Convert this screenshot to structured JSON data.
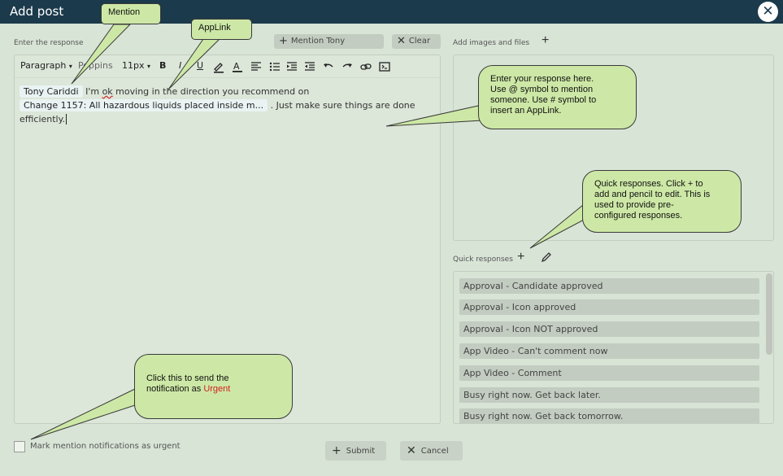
{
  "window": {
    "title": "Add post",
    "close_icon": "close-icon"
  },
  "response": {
    "label": "Enter the response",
    "mention_button": "Mention Tony",
    "clear_button": "Clear"
  },
  "toolbar": {
    "block_format": "Paragraph",
    "font_family": "Poppins",
    "font_size": "11px",
    "bold": "B",
    "italic": "I",
    "underline": "U",
    "text_color": "A",
    "icons": [
      "bold-icon",
      "italic-icon",
      "underline-icon",
      "highlight-icon",
      "text-color-icon",
      "align-left-icon",
      "bullet-list-icon",
      "indent-icon",
      "outdent-icon",
      "undo-icon",
      "redo-icon",
      "link-icon",
      "code-icon"
    ]
  },
  "editor": {
    "mention_chip": "Tony Cariddi",
    "text_1": "I'm ",
    "text_ok": "ok",
    "text_2": " moving in the direction you recommend on",
    "applink_chip": "Change 1157: All hazardous liquids placed inside m...",
    "text_3": ".  Just make sure things are done",
    "text_4": "efficiently."
  },
  "attachments": {
    "label": "Add images and files"
  },
  "quick_responses": {
    "label": "Quick responses",
    "items": [
      "Approval - Candidate approved",
      "Approval - Icon approved",
      "Approval - Icon NOT approved",
      "App Video - Can't comment now",
      "App Video - Comment",
      "Busy right now.  Get back later.",
      "Busy right now. Get back tomorrow."
    ]
  },
  "footer": {
    "urgent_label": "Mark mention notifications as urgent",
    "submit": "Submit",
    "cancel": "Cancel"
  },
  "callouts": {
    "mention": "Mention",
    "applink": "AppLink",
    "editor_line1": "Enter your response here.",
    "editor_line2": "Use @ symbol to mention",
    "editor_line3": "someone.  Use # symbol to",
    "editor_line4": "insert an AppLink.",
    "quick_line1": "Quick responses.  Click + to",
    "quick_line2": "add and pencil to edit.  This is",
    "quick_line3": "used to provide pre-",
    "quick_line4": "configured responses.",
    "urgent_line1": "Click this to send the",
    "urgent_line2": "notification as ",
    "urgent_word": "Urgent"
  },
  "colors": {
    "titlebar": "#1b3a4b",
    "background": "#d8e4d6",
    "callout": "#cde8a6",
    "urgent": "#d02020"
  }
}
